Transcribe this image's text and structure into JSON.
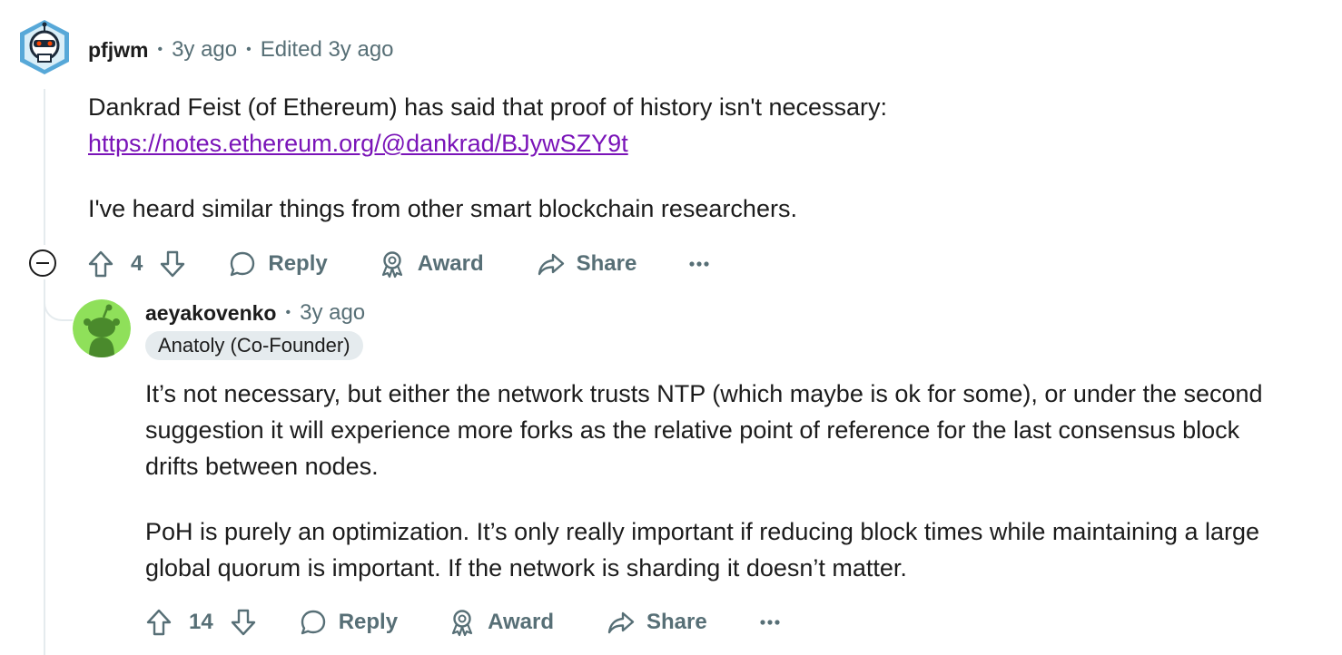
{
  "comments": [
    {
      "author": "pfjwm",
      "time": "3y ago",
      "edited": "Edited 3y ago",
      "paragraph1": "Dankrad Feist (of Ethereum) has said that proof of history isn't necessary:",
      "link": "https://notes.ethereum.org/@dankrad/BJywSZY9t",
      "paragraph2": "I've heard similar things from other smart blockchain researchers.",
      "votes": "4",
      "reply_label": "Reply",
      "award_label": "Award",
      "share_label": "Share"
    },
    {
      "author": "aeyakovenko",
      "time": "3y ago",
      "flair": "Anatoly (Co-Founder)",
      "paragraph1": "It’s not necessary, but either the network trusts NTP (which maybe is ok for some), or under the second suggestion it will experience more forks as the relative point of reference for the last consensus block drifts between nodes.",
      "paragraph2": "PoH is purely an optimization. It’s only really important if reducing block times while maintaining a large global quorum is important. If the network is sharding it doesn’t matter.",
      "votes": "14",
      "reply_label": "Reply",
      "award_label": "Award",
      "share_label": "Share"
    }
  ],
  "icons": {
    "upvote": "upvote-arrow-icon",
    "downvote": "downvote-arrow-icon",
    "reply": "speech-bubble-icon",
    "award": "award-ribbon-icon",
    "share": "share-arrow-icon",
    "more": "ellipsis-icon",
    "collapse": "minus-circle-icon"
  },
  "colors": {
    "link": "#7a14b8",
    "meta": "#576f76",
    "thread_line": "#e5ebee",
    "flair_bg": "#e5ebee",
    "avatar2_bg": "#8fe05a"
  }
}
